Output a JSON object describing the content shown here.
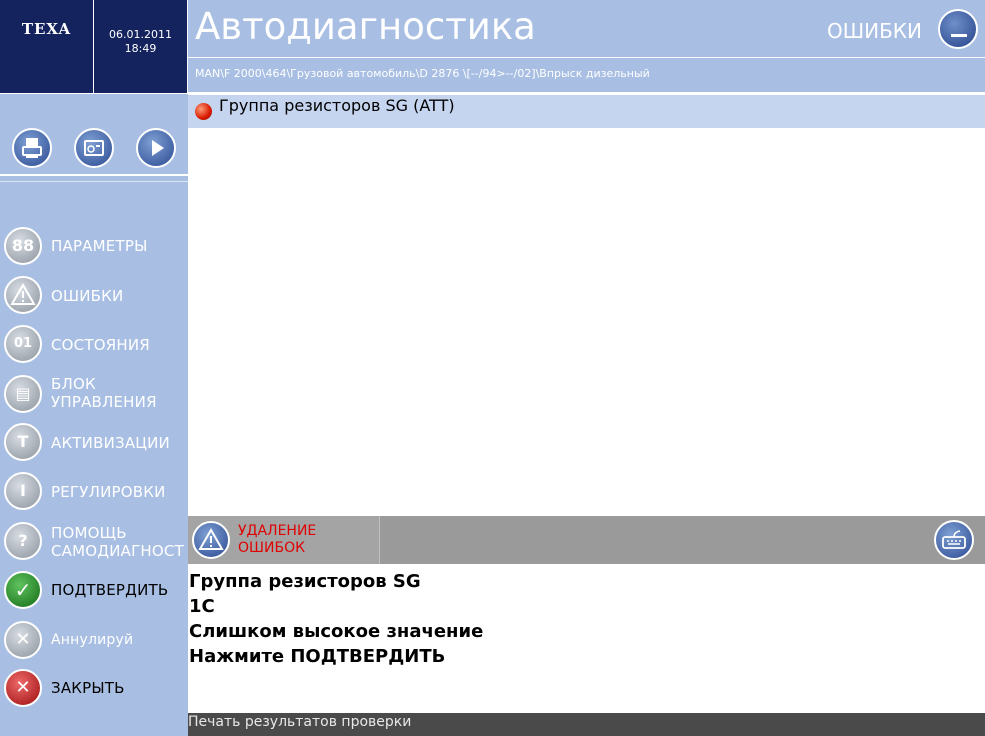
{
  "header": {
    "logo": "TEXA",
    "date": "06.01.2011",
    "time": "18:49",
    "title": "Автодиагностика",
    "mode": "ОШИБКИ",
    "path": "MAN\\F 2000\\464\\Грузовой автомобиль\\D 2876 \\[--/94>--/02]\\Впрыск дизельный"
  },
  "toolbar": {
    "icons": [
      "print-icon",
      "save-icon",
      "play-icon"
    ]
  },
  "sidebar": {
    "items": [
      {
        "label": "ПАРАМЕТРЫ",
        "icon": "88",
        "icon_name": "parameters-icon"
      },
      {
        "label": "ОШИБКИ",
        "icon": "!",
        "icon_name": "warning-icon"
      },
      {
        "label": "СОСТОЯНИЯ",
        "icon": "01",
        "icon_name": "states-icon"
      },
      {
        "label": "БЛОК\nУПРАВЛЕНИЯ",
        "icon": "▤",
        "icon_name": "control-unit-icon"
      },
      {
        "label": "АКТИВИЗАЦИИ",
        "icon": "T",
        "icon_name": "activation-icon"
      },
      {
        "label": "РЕГУЛИРОВКИ",
        "icon": "I",
        "icon_name": "adjustments-icon"
      },
      {
        "label": "ПОМОЩЬ\nСАМОДИАГНОСТ",
        "icon": "?",
        "icon_name": "help-icon"
      },
      {
        "label": "ПОДТВЕРДИТЬ",
        "icon": "✓",
        "icon_name": "check-icon"
      },
      {
        "label": "Аннулируй",
        "icon": "✕",
        "icon_name": "cancel-icon"
      },
      {
        "label": "ЗАКРЫТЬ",
        "icon": "✕",
        "icon_name": "close-icon"
      }
    ]
  },
  "error_row": {
    "label": "Группа резисторов SG (ATT)"
  },
  "action": {
    "label": "УДАЛЕНИЕ ОШИБОК"
  },
  "message": {
    "line1": "Группа резисторов SG",
    "line2": "1C",
    "line3": "Слишком высокое значение",
    "line4": "Нажмите ПОДТВЕРДИТЬ"
  },
  "status": {
    "text": "Печать результатов проверки"
  },
  "colors": {
    "navy": "#14225e",
    "light_blue": "#a8bfe3",
    "row_blue": "#c5d5ef",
    "action_gray": "#9a9a9a",
    "alert_red": "#e00000"
  }
}
